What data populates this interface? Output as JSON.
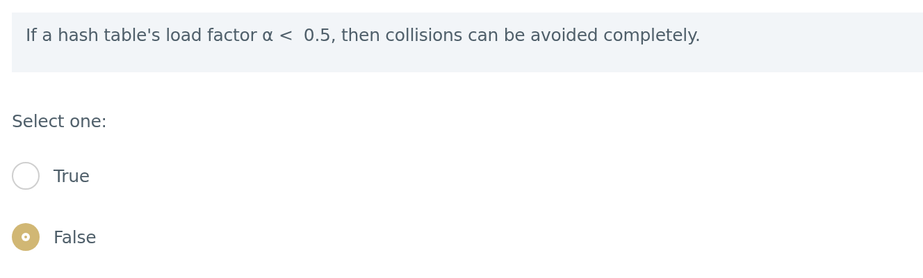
{
  "question": {
    "text": "If a hash table's load factor α <  0.5, then collisions can be avoided completely."
  },
  "prompt": "Select one:",
  "options": [
    {
      "label": "True",
      "selected": false
    },
    {
      "label": "False",
      "selected": true
    }
  ]
}
